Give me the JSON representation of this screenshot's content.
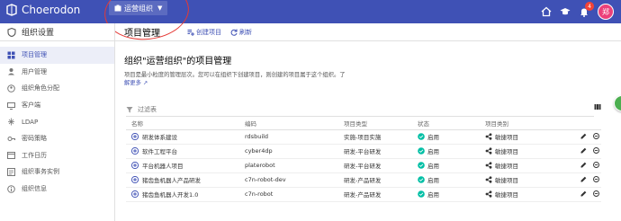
{
  "app": {
    "name": "Choerodon"
  },
  "org_switcher": {
    "label": "运营组织"
  },
  "topbar": {
    "badge_count": "4",
    "avatar_text": "郑"
  },
  "sidebar": {
    "title": "组织设置",
    "items": [
      {
        "label": "项目管理",
        "icon": "project-icon"
      },
      {
        "label": "用户管理",
        "icon": "user-icon"
      },
      {
        "label": "组织角色分配",
        "icon": "role-icon"
      },
      {
        "label": "客户端",
        "icon": "client-icon"
      },
      {
        "label": "LDAP",
        "icon": "ldap-icon"
      },
      {
        "label": "密码策略",
        "icon": "password-icon"
      },
      {
        "label": "工作日历",
        "icon": "calendar-icon"
      },
      {
        "label": "组织事务实例",
        "icon": "instance-icon"
      },
      {
        "label": "组织信息",
        "icon": "info-icon"
      }
    ]
  },
  "page": {
    "title": "项目管理",
    "create_label": "创建项目",
    "refresh_label": "刷新",
    "section_title": "组织\"运营组织\"的项目管理",
    "description": "项目是最小粒度的管理层次。您可以在组织下创建项目，则创建的项目属于这个组织。了",
    "more": "解更多"
  },
  "filter": {
    "placeholder": "过滤表"
  },
  "table": {
    "headers": {
      "name": "名称",
      "code": "编码",
      "type": "项目类型",
      "status": "状态",
      "category": "项目类别"
    },
    "rows": [
      {
        "name": "研发体系建设",
        "code": "rdsbuild",
        "type": "实施-项目实施",
        "status": "启用",
        "category": "敏捷项目"
      },
      {
        "name": "软件工程平台",
        "code": "cyber4dp",
        "type": "研发-平台研发",
        "status": "启用",
        "category": "敏捷项目"
      },
      {
        "name": "平台机器人项目",
        "code": "platerobot",
        "type": "研发-平台研发",
        "status": "启用",
        "category": "敏捷项目"
      },
      {
        "name": "猪齿鱼机器人产品研发",
        "code": "c7n-robot-dev",
        "type": "研发-产品研发",
        "status": "启用",
        "category": "敏捷项目"
      },
      {
        "name": "猪齿鱼机器人开发1.0",
        "code": "c7n-robot",
        "type": "研发-产品研发",
        "status": "启用",
        "category": "敏捷项目"
      }
    ]
  },
  "colors": {
    "primary": "#3f51b5",
    "success": "#00bfa5",
    "annotation": "#e53935"
  }
}
